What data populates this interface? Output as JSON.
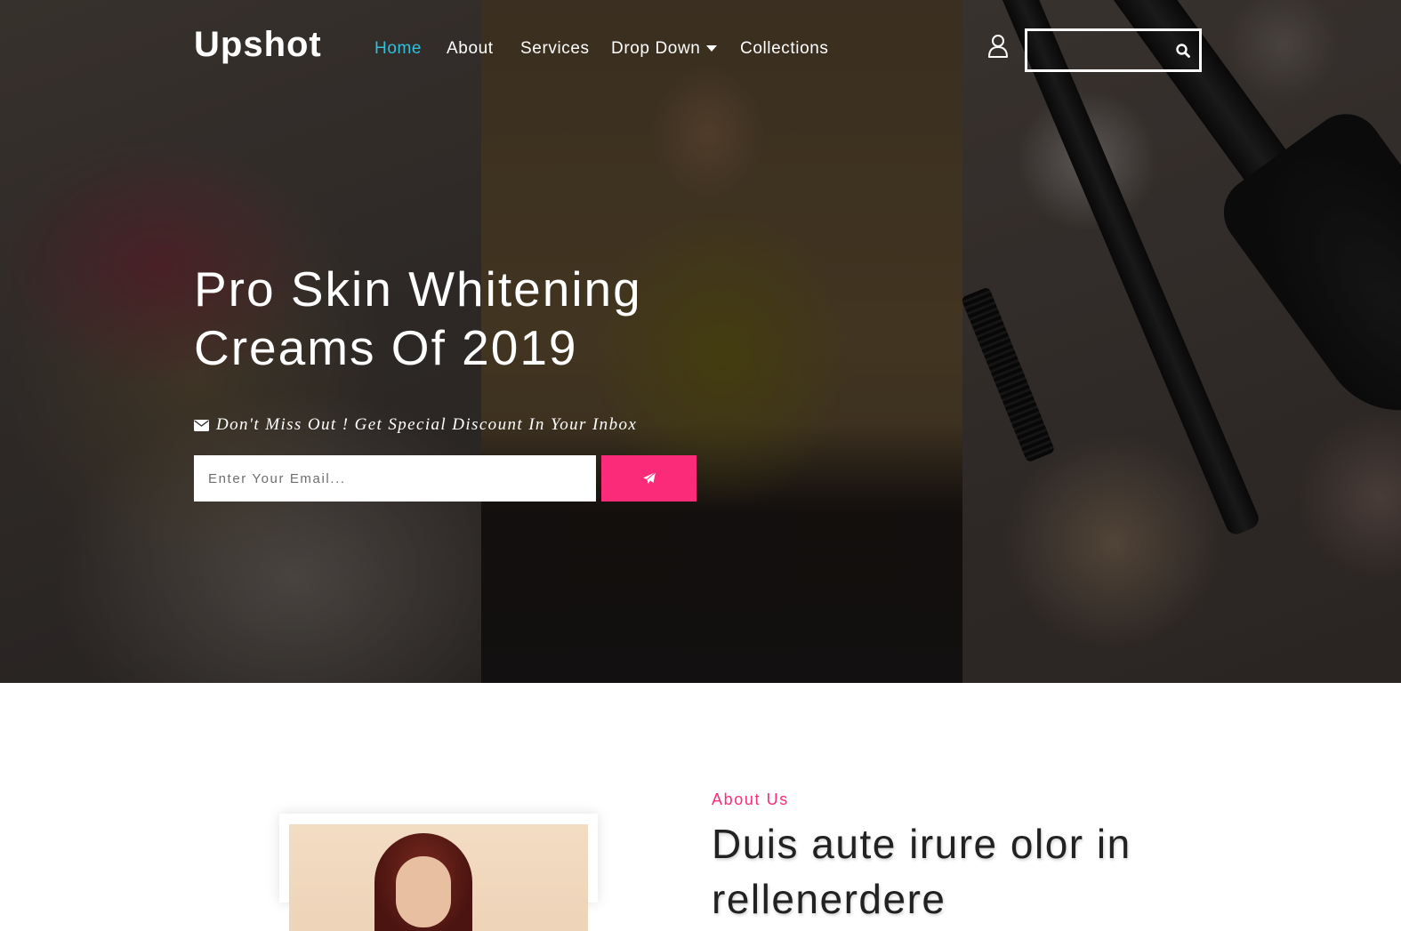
{
  "brand": {
    "logo": "Upshot"
  },
  "nav": {
    "items": [
      {
        "label": "Home",
        "active": true
      },
      {
        "label": "About",
        "active": false
      },
      {
        "label": "Services",
        "active": false
      },
      {
        "label": "Drop Down",
        "active": false,
        "has_dropdown": true
      },
      {
        "label": "Collections",
        "active": false
      }
    ],
    "search": {
      "value": "",
      "placeholder": ""
    }
  },
  "hero": {
    "title_line1": "Pro Skin Whitening",
    "title_line2": "Creams Of 2019",
    "promo_text": "Don't Miss Out ! Get Special Discount In Your Inbox",
    "email_placeholder": "Enter Your Email..."
  },
  "about": {
    "kicker": "About Us",
    "heading": "Duis aute irure olor in rellenerdere"
  },
  "icons": [
    "user-icon",
    "search-icon",
    "envelope-icon",
    "paper-plane-icon",
    "caret-down-icon"
  ],
  "colors": {
    "accent_pink": "#fb2b7a",
    "nav_active": "#30bfdc",
    "heading_text": "#222222",
    "hero_text": "#ffffff"
  }
}
